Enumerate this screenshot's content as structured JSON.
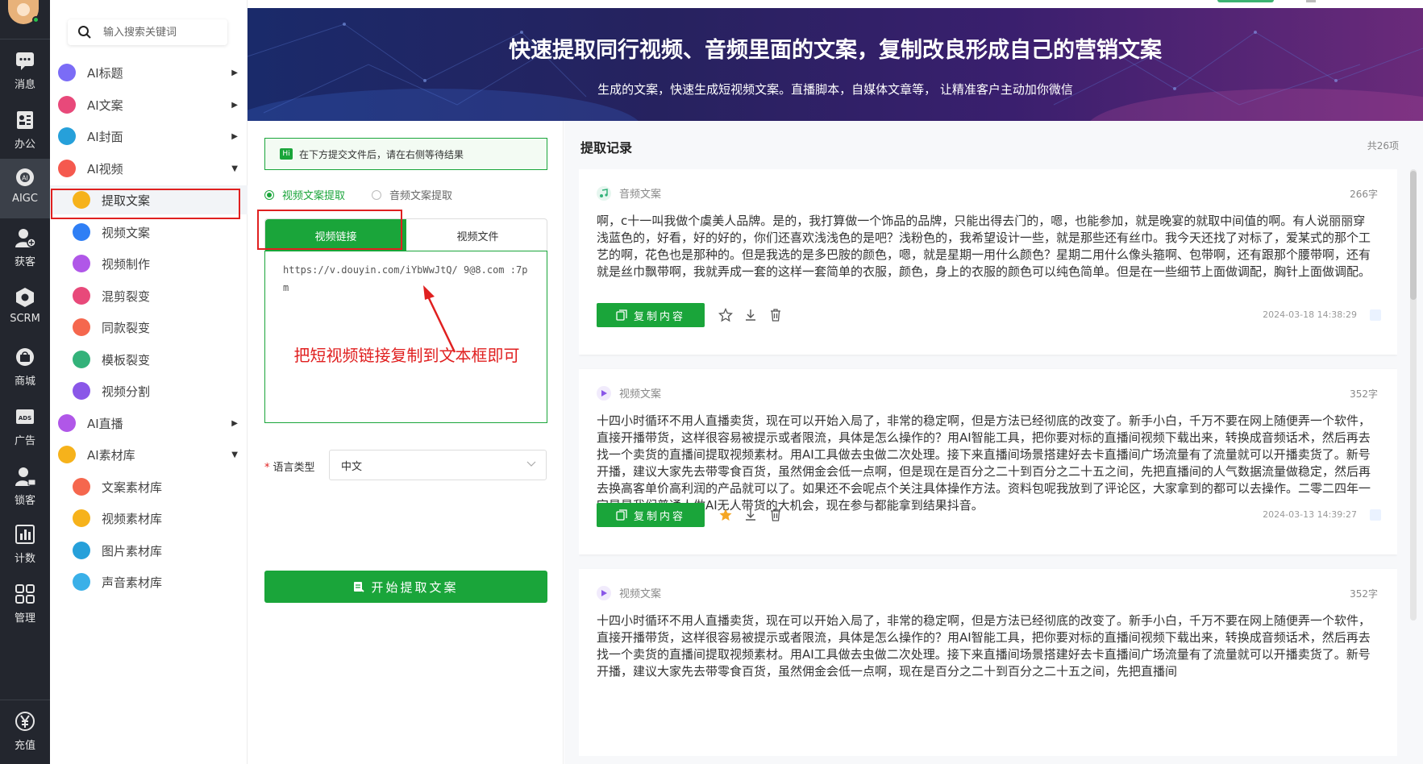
{
  "rail": {
    "items": [
      {
        "label": "消息",
        "icon": "chat-icon"
      },
      {
        "label": "办公",
        "icon": "office-icon"
      },
      {
        "label": "AIGC",
        "icon": "ai-icon"
      },
      {
        "label": "获客",
        "icon": "user-add-icon"
      },
      {
        "label": "SCRM",
        "icon": "scrm-icon"
      },
      {
        "label": "商城",
        "icon": "shop-icon"
      },
      {
        "label": "广告",
        "icon": "ads-icon"
      },
      {
        "label": "锁客",
        "icon": "lock-user-icon"
      },
      {
        "label": "计数",
        "icon": "count-icon"
      },
      {
        "label": "管理",
        "icon": "grid-icon"
      },
      {
        "label": "充值",
        "icon": "yen-icon"
      }
    ]
  },
  "sidebar": {
    "search_placeholder": "输入搜索关键词",
    "items": [
      {
        "label": "AI标题",
        "level": 1,
        "color": "#7b6cf6",
        "arrow": "▶"
      },
      {
        "label": "AI文案",
        "level": 1,
        "color": "#e8497a",
        "arrow": "▶"
      },
      {
        "label": "AI封面",
        "level": 1,
        "color": "#26a0da",
        "arrow": "▶"
      },
      {
        "label": "AI视频",
        "level": 1,
        "color": "#f5594e",
        "arrow": "▼"
      },
      {
        "label": "提取文案",
        "level": 2,
        "color": "#f6b21b",
        "arrow": ""
      },
      {
        "label": "视频文案",
        "level": 2,
        "color": "#2f7ff5",
        "arrow": ""
      },
      {
        "label": "视频制作",
        "level": 2,
        "color": "#b057e8",
        "arrow": ""
      },
      {
        "label": "混剪裂变",
        "level": 2,
        "color": "#e8497a",
        "arrow": ""
      },
      {
        "label": "同款裂变",
        "level": 2,
        "color": "#f5674e",
        "arrow": ""
      },
      {
        "label": "模板裂变",
        "level": 2,
        "color": "#33b27a",
        "arrow": ""
      },
      {
        "label": "视频分割",
        "level": 2,
        "color": "#8a57e8",
        "arrow": ""
      },
      {
        "label": "AI直播",
        "level": 1,
        "color": "#b057e8",
        "arrow": "▶"
      },
      {
        "label": "AI素材库",
        "level": 1,
        "color": "#f6b21b",
        "arrow": "▼"
      },
      {
        "label": "文案素材库",
        "level": 2,
        "color": "#f5674e",
        "arrow": ""
      },
      {
        "label": "视频素材库",
        "level": 2,
        "color": "#f6b21b",
        "arrow": ""
      },
      {
        "label": "图片素材库",
        "level": 2,
        "color": "#26a0da",
        "arrow": ""
      },
      {
        "label": "声音素材库",
        "level": 2,
        "color": "#3ab0e8",
        "arrow": ""
      }
    ]
  },
  "banner": {
    "title": "快速提取同行视频、音频里面的文案，复制改良形成自己的营销文案",
    "subtitle": "生成的文案，快速生成短视频文案。直播脚本，自媒体文章等， 让精准客户主动加你微信"
  },
  "form": {
    "notice_badge": "Hi",
    "notice": "在下方提交文件后，请在右侧等待结果",
    "radio_video": "视频文案提取",
    "radio_audio": "音频文案提取",
    "tab_link": "视频链接",
    "tab_file": "视频文件",
    "url_value": "https://v.douyin.com/iYbWwJtQ/ 9@8.com :7pm",
    "annotation": "把短视频链接复制到文本框即可",
    "lang_label": "语言类型",
    "lang_value": "中文",
    "start_button": "开始提取文案"
  },
  "records": {
    "title": "提取记录",
    "count": "共26项",
    "cards": [
      {
        "type": "音频文案",
        "chars": "266字",
        "text": "啊，c十一叫我做个虞美人品牌。是的，我打算做一个饰品的品牌，只能出得去门的，嗯，也能参加，就是晚宴的就取中间值的啊。有人说丽丽穿浅蓝色的，好看，好的好的，你们还喜欢浅浅色的是吧？浅粉色的，我希望设计一些，就是那些还有丝巾。我今天还找了对标了，爱某式的那个工艺的啊，花色也是那种的。但是我选的是多巴胺的颜色，嗯，就是星期一用什么颜色？星期二用什么像头箍啊、包带啊，还有跟那个腰带啊，还有就是丝巾飘带啊，我就弄成一套的这样一套简单的衣服，颜色，身上的衣服的颜色可以纯色简单。但是在一些细节上面做调配，胸针上面做调配。",
        "copy": "复制内容",
        "timestamp": "2024-03-18 14:38:29",
        "starred": false
      },
      {
        "type": "视频文案",
        "chars": "352字",
        "text": "十四小时循环不用人直播卖货，现在可以开始入局了，非常的稳定啊，但是方法已经彻底的改变了。新手小白，千万不要在网上随便弄一个软件，直接开播带货，这样很容易被提示或者限流，具体是怎么操作的？用AI智能工具，把你要对标的直播间视频下载出来，转换成音频话术，然后再去找一个卖货的直播间提取视频素材。用AI工具做去虫做二次处理。接下来直播间场景搭建好去卡直播间广场流量有了流量就可以开播卖货了。新号开播，建议大家先去带零食百货，虽然佣金会低一点啊，但是现在是百分之二十到百分之二十五之间，先把直播间的人气数据流量做稳定，然后再去换高客单价高利润的产品就可以了。如果还不会呢点个关注具体操作方法。资料包呢我放到了评论区，大家拿到的都可以去操作。二零二四年一定是是我们普通人做AI无人带货的大机会，现在参与都能拿到结果抖音。",
        "copy": "复制内容",
        "timestamp": "2024-03-13 14:39:27",
        "starred": true
      },
      {
        "type": "视频文案",
        "chars": "352字",
        "text": "十四小时循环不用人直播卖货，现在可以开始入局了，非常的稳定啊，但是方法已经彻底的改变了。新手小白，千万不要在网上随便弄一个软件，直接开播带货，这样很容易被提示或者限流，具体是怎么操作的？用AI智能工具，把你要对标的直播间视频下载出来，转换成音频话术，然后再去找一个卖货的直播间提取视频素材。用AI工具做去虫做二次处理。接下来直播间场景搭建好去卡直播间广场流量有了流量就可以开播卖货了。新号开播，建议大家先去带零食百货，虽然佣金会低一点啊，现在是百分之二十到百分之二十五之间，先把直播间",
        "copy": "复制内容",
        "timestamp": "",
        "starred": false
      }
    ]
  }
}
